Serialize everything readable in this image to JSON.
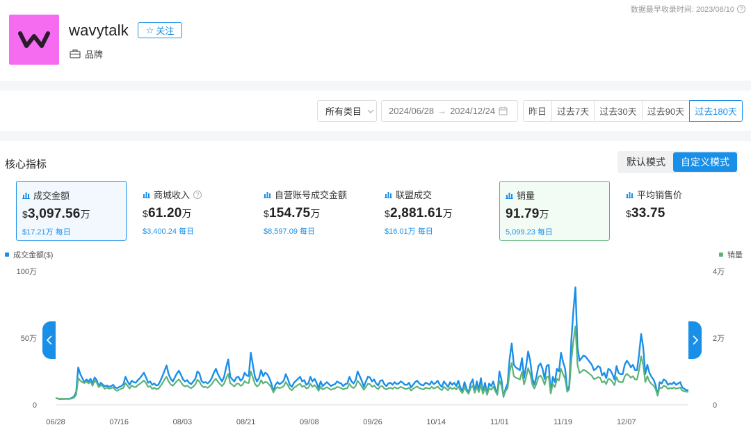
{
  "header": {
    "brand_name": "wavytalk",
    "follow_label": "关注",
    "brand_type": "品牌",
    "earliest_record": "数据最早收录时间: 2023/08/10",
    "logo_color": "#f56cf0"
  },
  "filters": {
    "category": "所有类目",
    "date_start": "2024/06/28",
    "date_end": "2024/12/24",
    "quick_ranges": [
      "昨日",
      "过去7天",
      "过去30天",
      "过去90天",
      "过去180天"
    ],
    "active_range": "过去180天"
  },
  "core": {
    "title": "核心指标",
    "modes": [
      "默认模式",
      "自定义模式"
    ],
    "active_mode": "自定义模式"
  },
  "metrics": [
    {
      "label": "成交金额",
      "currency": "$",
      "value": "3,097.56",
      "unit": "万",
      "daily": "$17.21万 每日"
    },
    {
      "label": "商城收入",
      "currency": "$",
      "value": "61.20",
      "unit": "万",
      "daily": "$3,400.24 每日"
    },
    {
      "label": "自营账号成交金额",
      "currency": "$",
      "value": "154.75",
      "unit": "万",
      "daily": "$8,597.09 每日"
    },
    {
      "label": "联盟成交",
      "currency": "$",
      "value": "2,881.61",
      "unit": "万",
      "daily": "$16.01万 每日"
    },
    {
      "label": "销量",
      "currency": "",
      "value": "91.79",
      "unit": "万",
      "daily": "5,099.23 每日"
    },
    {
      "label": "平均销售价",
      "currency": "$",
      "value": "33.75",
      "unit": "",
      "daily": ""
    }
  ],
  "colors": {
    "accent": "#1a8fe8",
    "series_blue": "#1a8fe8",
    "series_green": "#5cb377"
  },
  "chart_data": {
    "type": "line",
    "x_ticks": [
      "06/28",
      "07/16",
      "08/03",
      "08/21",
      "09/08",
      "09/26",
      "10/14",
      "11/01",
      "11/19",
      "12/07"
    ],
    "y_left": {
      "ticks": [
        "0",
        "50万",
        "100万"
      ],
      "range": [
        0,
        1000000
      ]
    },
    "y_right": {
      "ticks": [
        "0",
        "2万",
        "4万"
      ],
      "range": [
        0,
        40000
      ]
    },
    "series": [
      {
        "name": "成交金额($)",
        "axis": "left",
        "color": "#1a8fe8",
        "values": [
          50000,
          48000,
          42000,
          45000,
          43000,
          46000,
          44000,
          47000,
          52000,
          65000,
          95000,
          280000,
          230000,
          200000,
          170000,
          190000,
          175000,
          195000,
          160000,
          205000,
          185000,
          140000,
          165000,
          150000,
          140000,
          145000,
          135000,
          140000,
          150000,
          130000,
          125000,
          135000,
          140000,
          155000,
          210000,
          175000,
          150000,
          180000,
          170000,
          165000,
          185000,
          200000,
          220000,
          240000,
          205000,
          165000,
          175000,
          150000,
          160000,
          145000,
          150000,
          180000,
          215000,
          255000,
          295000,
          230000,
          195000,
          175000,
          205000,
          235000,
          255000,
          225000,
          190000,
          175000,
          185000,
          165000,
          155000,
          175000,
          195000,
          250000,
          235000,
          180000,
          165000,
          170000,
          160000,
          175000,
          200000,
          240000,
          270000,
          230000,
          200000,
          175000,
          210000,
          280000,
          340000,
          210000,
          190000,
          175000,
          205000,
          210000,
          180000,
          195000,
          240000,
          220000,
          215000,
          390000,
          300000,
          210000,
          175000,
          200000,
          260000,
          215000,
          240000,
          230000,
          200000,
          160000,
          100000,
          150000,
          170000,
          155000,
          165000,
          180000,
          230000,
          195000,
          150000,
          135000,
          165000,
          180000,
          195000,
          210000,
          175000,
          185000,
          150000,
          160000,
          210000,
          175000,
          195000,
          165000,
          125000,
          175000,
          140000,
          155000,
          170000,
          155000,
          140000,
          150000,
          155000,
          175000,
          165000,
          160000,
          140000,
          155000,
          160000,
          210000,
          175000,
          160000,
          185000,
          250000,
          215000,
          180000,
          135000,
          175000,
          210000,
          205000,
          175000,
          190000,
          160000,
          145000,
          180000,
          185000,
          155000,
          140000,
          160000,
          165000,
          150000,
          170000,
          155000,
          160000,
          175000,
          165000,
          150000,
          150000,
          165000,
          130000,
          150000,
          170000,
          180000,
          160000,
          150000,
          145000,
          165000,
          160000,
          150000,
          175000,
          155000,
          165000,
          180000,
          150000,
          135000,
          175000,
          155000,
          135000,
          170000,
          150000,
          165000,
          140000,
          180000,
          130000,
          100000,
          170000,
          120000,
          90000,
          160000,
          190000,
          100000,
          175000,
          110000,
          200000,
          90000,
          165000,
          80000,
          160000,
          140000,
          175000,
          120000,
          80000,
          250000,
          190000,
          60000,
          120000,
          160000,
          350000,
          460000,
          300000,
          280000,
          270000,
          260000,
          350000,
          200000,
          290000,
          400000,
          330000,
          200000,
          150000,
          210000,
          290000,
          310000,
          270000,
          195000,
          290000,
          300000,
          90000,
          210000,
          170000,
          270000,
          250000,
          390000,
          320000,
          270000,
          110000,
          140000,
          480000,
          700000,
          880000,
          430000,
          330000,
          350000,
          370000,
          360000,
          340000,
          320000,
          300000,
          260000,
          270000,
          290000,
          280000,
          220000,
          240000,
          200000,
          270000,
          260000,
          230000,
          190000,
          290000,
          240000,
          230000,
          230000,
          300000,
          330000,
          310000,
          280000,
          300000,
          260000,
          260000,
          380000,
          530000,
          430000,
          230000,
          300000,
          240000,
          210000,
          190000,
          150000,
          70000,
          170000,
          160000,
          190000,
          180000,
          150000,
          160000,
          155000,
          170000,
          150000,
          160000,
          170000,
          130000,
          120000,
          110000,
          110000
        ]
      },
      {
        "name": "销量",
        "axis": "right",
        "color": "#5cb377",
        "values": [
          2000,
          1900,
          1800,
          1850,
          1750,
          1800,
          1700,
          1800,
          1900,
          2200,
          3000,
          8000,
          7200,
          6800,
          6500,
          7000,
          6400,
          6900,
          5700,
          7300,
          6600,
          5300,
          5900,
          5500,
          4800,
          5200,
          4800,
          5000,
          5200,
          4500,
          4200,
          4600,
          4800,
          5100,
          6500,
          5700,
          4900,
          5800,
          5400,
          5300,
          5900,
          6300,
          6800,
          7300,
          6500,
          5400,
          5600,
          4800,
          5100,
          4700,
          4800,
          5600,
          6500,
          7600,
          8400,
          7000,
          6100,
          5700,
          6400,
          7100,
          7600,
          6800,
          5900,
          5500,
          5800,
          5300,
          5000,
          5500,
          6100,
          7500,
          7000,
          5800,
          5300,
          5400,
          5100,
          5600,
          6200,
          7200,
          7800,
          6900,
          6200,
          5600,
          6400,
          7900,
          9300,
          6500,
          6000,
          5500,
          6300,
          6400,
          5700,
          6000,
          7100,
          6600,
          6500,
          10000,
          8200,
          6300,
          5500,
          6000,
          7400,
          6400,
          6900,
          6700,
          6000,
          5200,
          3700,
          4800,
          5300,
          5000,
          5200,
          5600,
          6800,
          5900,
          4800,
          4400,
          5100,
          5500,
          6000,
          6300,
          5400,
          5700,
          4900,
          5100,
          6300,
          5400,
          5900,
          5200,
          4200,
          5400,
          4600,
          4900,
          5300,
          4900,
          4500,
          4800,
          4900,
          5400,
          5200,
          5000,
          4600,
          4900,
          5000,
          6300,
          5400,
          5000,
          5600,
          7200,
          6400,
          5500,
          4500,
          5400,
          6300,
          6200,
          5400,
          5800,
          5100,
          4700,
          5500,
          5600,
          4900,
          4600,
          5000,
          5100,
          4800,
          5300,
          4900,
          5000,
          5400,
          5100,
          4800,
          4800,
          5100,
          4300,
          4800,
          5200,
          5500,
          5000,
          4800,
          4600,
          5100,
          5000,
          4800,
          5400,
          4900,
          5100,
          5500,
          4800,
          4400,
          5400,
          4900,
          4400,
          5300,
          4700,
          5100,
          4600,
          5500,
          4300,
          3500,
          5300,
          4100,
          3300,
          5000,
          5700,
          3600,
          5400,
          3800,
          6000,
          3300,
          5100,
          3000,
          5000,
          4500,
          5400,
          4100,
          3000,
          7300,
          5800,
          2600,
          4100,
          5000,
          10000,
          12500,
          8600,
          8100,
          7900,
          7600,
          9900,
          6100,
          8300,
          11000,
          9300,
          6100,
          4900,
          6300,
          8300,
          8800,
          7800,
          6000,
          8300,
          8500,
          3400,
          6300,
          5300,
          7800,
          7300,
          10800,
          9100,
          7800,
          3900,
          4700,
          13200,
          19000,
          23500,
          12000,
          9500,
          10000,
          10500,
          10200,
          9700,
          9200,
          8700,
          7700,
          7900,
          8300,
          8100,
          6700,
          7100,
          6200,
          7800,
          7600,
          6900,
          5900,
          8300,
          7000,
          6800,
          6800,
          8500,
          9300,
          8800,
          8100,
          8600,
          7600,
          7600,
          10500,
          14500,
          12000,
          6800,
          8600,
          7000,
          6300,
          5800,
          4800,
          2800,
          5200,
          5000,
          5700,
          5500,
          4800,
          5000,
          4900,
          5200,
          4800,
          5000,
          5200,
          4300,
          4100,
          3900,
          3900
        ]
      }
    ]
  }
}
